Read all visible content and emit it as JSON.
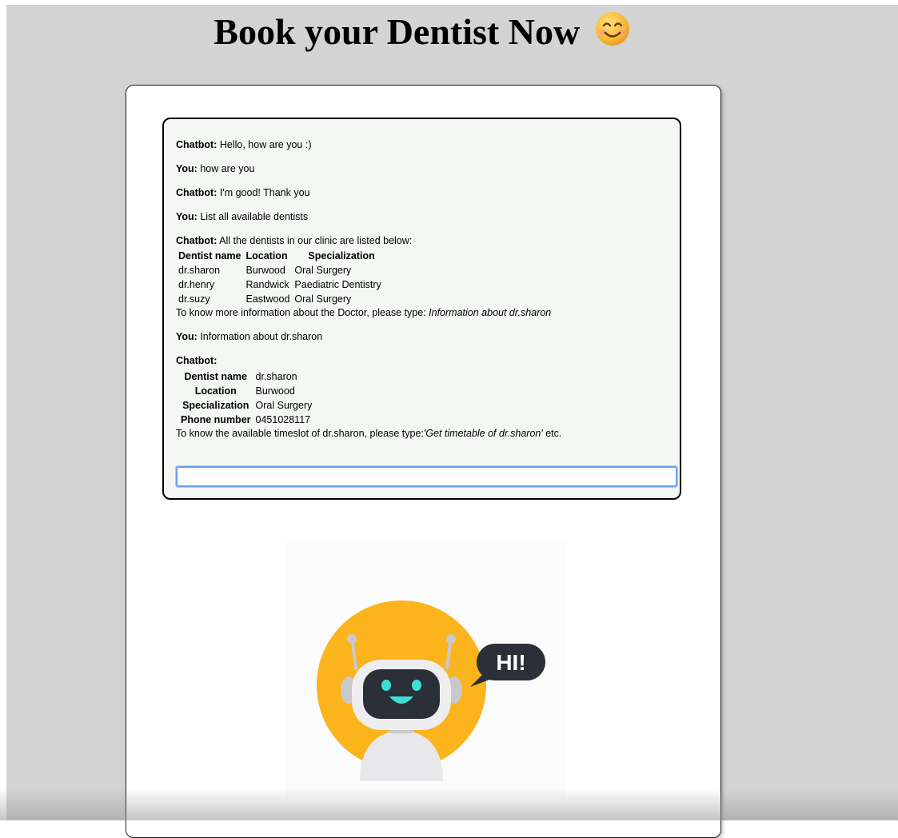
{
  "page": {
    "title": "Book your Dentist Now",
    "title_emoji": "smiling-face-emoji"
  },
  "chat": {
    "messages": [
      {
        "speaker": "Chatbot:",
        "text": "Hello, how are you :)"
      },
      {
        "speaker": "You:",
        "text": "how are you"
      },
      {
        "speaker": "Chatbot:",
        "text": "I'm good! Thank you"
      },
      {
        "speaker": "You:",
        "text": "List all available dentists"
      }
    ],
    "dentist_list": {
      "speaker": "Chatbot:",
      "intro": "All the dentists in our clinic are listed below:",
      "headers": [
        "Dentist name",
        "Location",
        "Specialization"
      ],
      "rows": [
        [
          "dr.sharon",
          "Burwood",
          "Oral Surgery"
        ],
        [
          "dr.henry",
          "Randwick",
          "Paediatric Dentistry"
        ],
        [
          "dr.suzy",
          "Eastwood",
          "Oral Surgery"
        ]
      ],
      "note_prefix": "To know more information about the Doctor, please type: ",
      "note_example": "Information about dr.sharon"
    },
    "user_query": {
      "speaker": "You:",
      "text": "Information about dr.sharon"
    },
    "dentist_detail": {
      "speaker": "Chatbot:",
      "fields": [
        {
          "label": "Dentist name",
          "value": "dr.sharon"
        },
        {
          "label": "Location",
          "value": "Burwood"
        },
        {
          "label": "Specialization",
          "value": "Oral Surgery"
        },
        {
          "label": "Phone number",
          "value": "0451028117"
        }
      ],
      "note_prefix": "To know the available timeslot of dr.sharon, please type:",
      "note_example": "'Get timetable of dr.sharon'",
      "note_suffix": " etc."
    },
    "input": {
      "value": "",
      "placeholder": ""
    }
  },
  "illustration": {
    "icon": "robot-hi-icon",
    "speech_text": "HI!",
    "colors": {
      "circle": "#fbb41b",
      "bubble": "#2b2f38",
      "face": "#2b2f38",
      "eyes": "#3ee0d3",
      "head": "#e8e8ea"
    }
  }
}
